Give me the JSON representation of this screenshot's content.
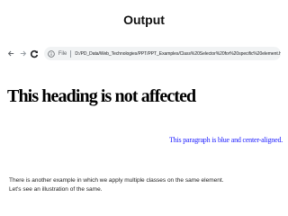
{
  "slide": {
    "title": "Output"
  },
  "browser": {
    "back_icon": "arrow-left-icon",
    "forward_icon": "arrow-right-icon",
    "reload_icon": "reload-icon",
    "file_label": "File",
    "url": "D:/PD_Data/Web_Technologies/PPT/PPT_Examples/Class%20Selector%20for%20specific%20element.html"
  },
  "page": {
    "heading": "This heading is not affected",
    "paragraph": "This paragraph is blue and center-aligned."
  },
  "caption": {
    "line1": "There is another example in which we apply multiple classes on the same element.",
    "line2": "Let's see an illustration of the same."
  },
  "colors": {
    "paragraph": "#1a1aff",
    "address_bar": "#f1f3f4"
  }
}
